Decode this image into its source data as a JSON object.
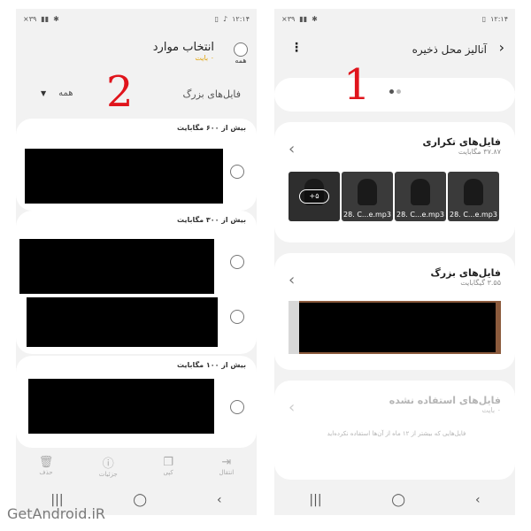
{
  "annotations": {
    "left_number": "2",
    "right_number": "1"
  },
  "status_bar": {
    "time": "۱۲:۱۴",
    "carrier_left": "×۳۹"
  },
  "left_screen": {
    "header": {
      "title": "انتخاب موارد",
      "subtitle": "۰ بایت",
      "select_all_label": "همه"
    },
    "filter": {
      "category": "فایل‌های بزرگ",
      "value": "همه"
    },
    "groups": [
      {
        "title": "بیش از ۶۰۰ مگابایت"
      },
      {
        "title": "بیش از ۳۰۰ مگابایت"
      },
      {
        "title": "بیش از ۱۰۰ مگابایت"
      }
    ],
    "toolbar": [
      {
        "label": "انتقال",
        "icon": "move-icon"
      },
      {
        "label": "کپی",
        "icon": "copy-icon"
      },
      {
        "label": "جزئیات",
        "icon": "info-icon"
      },
      {
        "label": "حذف",
        "icon": "trash-icon"
      }
    ]
  },
  "right_screen": {
    "header": {
      "title": "آنالیز محل ذخیره"
    },
    "duplicates": {
      "title": "فایل‌های تکراری",
      "subtitle": "۳۷.۸۷ مگابایت",
      "thumbs": [
        "28. C...e.mp3",
        "28. C...e.mp3",
        "28. C...e.mp3"
      ],
      "more_badge": "+۵"
    },
    "large_files": {
      "title": "فایل‌های بزرگ",
      "subtitle": "۳.۵۵ گیگابایت"
    },
    "unused": {
      "title": "فایل‌های استفاده نشده",
      "subtitle": "۰ بایت",
      "description": "فایل‌هایی که بیشتر از ۱۲ ماه از آن‌ها استفاده نکرده‌اید"
    }
  },
  "watermark": "GetAndroid.iR"
}
